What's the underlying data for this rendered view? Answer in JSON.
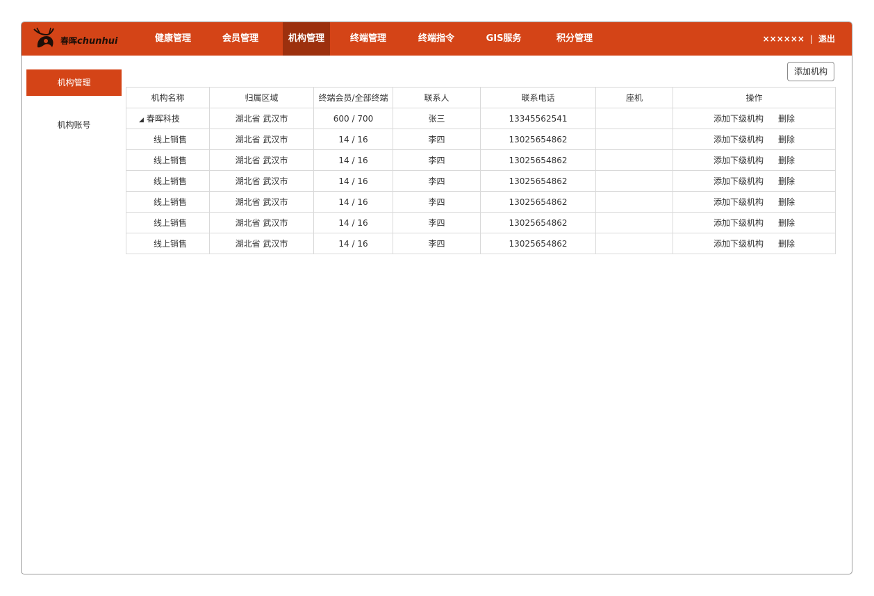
{
  "brand": {
    "logo_cn": "春晖",
    "logo_en": "chunhui"
  },
  "nav": {
    "items": [
      {
        "label": "健康管理"
      },
      {
        "label": "会员管理"
      },
      {
        "label": "机构管理"
      },
      {
        "label": "终端管理"
      },
      {
        "label": "终端指令"
      },
      {
        "label": "GIS服务"
      },
      {
        "label": "积分管理"
      }
    ],
    "active": "机构管理"
  },
  "user": {
    "name": "××××××",
    "separator": "|",
    "logout": "退出"
  },
  "sidebar": {
    "items": [
      {
        "label": "机构管理"
      },
      {
        "label": "机构账号"
      }
    ],
    "active": "机构管理"
  },
  "toolbar": {
    "add_label": "添加机构"
  },
  "table": {
    "headers": [
      "机构名称",
      "归属区域",
      "终端会员/全部终端",
      "联系人",
      "联系电话",
      "座机",
      "操作"
    ],
    "rows": [
      {
        "name": "春晖科技",
        "region": "湖北省 武汉市",
        "terminals": "600 / 700",
        "contact": "张三",
        "phone": "13345562541",
        "landline": "",
        "action_add": "添加下级机构",
        "action_delete": "删除"
      },
      {
        "name": "线上销售",
        "region": "湖北省 武汉市",
        "terminals": "14 / 16",
        "contact": "李四",
        "phone": "13025654862",
        "landline": "",
        "action_add": "添加下级机构",
        "action_delete": "删除"
      },
      {
        "name": "线上销售",
        "region": "湖北省 武汉市",
        "terminals": "14 / 16",
        "contact": "李四",
        "phone": "13025654862",
        "landline": "",
        "action_add": "添加下级机构",
        "action_delete": "删除"
      },
      {
        "name": "线上销售",
        "region": "湖北省 武汉市",
        "terminals": "14 / 16",
        "contact": "李四",
        "phone": "13025654862",
        "landline": "",
        "action_add": "添加下级机构",
        "action_delete": "删除"
      },
      {
        "name": "线上销售",
        "region": "湖北省 武汉市",
        "terminals": "14 / 16",
        "contact": "李四",
        "phone": "13025654862",
        "landline": "",
        "action_add": "添加下级机构",
        "action_delete": "删除"
      },
      {
        "name": "线上销售",
        "region": "湖北省 武汉市",
        "terminals": "14 / 16",
        "contact": "李四",
        "phone": "13025654862",
        "landline": "",
        "action_add": "添加下级机构",
        "action_delete": "删除"
      },
      {
        "name": "线上销售",
        "region": "湖北省 武汉市",
        "terminals": "14 / 16",
        "contact": "李四",
        "phone": "13025654862",
        "landline": "",
        "action_add": "添加下级机构",
        "action_delete": "删除"
      }
    ]
  },
  "colors": {
    "accent": "#d44417",
    "accent_dark": "#9c300e"
  },
  "icons": {
    "logo": "deer-logo-icon",
    "expand": "triangle-down-icon"
  }
}
